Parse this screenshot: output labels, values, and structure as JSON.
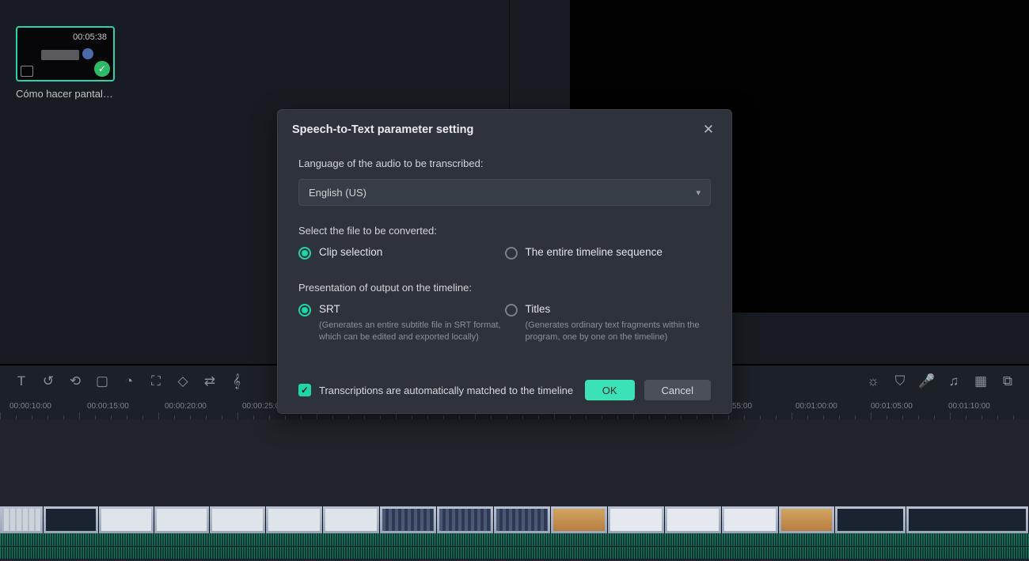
{
  "thumbnail": {
    "duration": "00:05:38",
    "caption": "Cómo hacer pantallas ..."
  },
  "dialog": {
    "title": "Speech-to-Text parameter setting",
    "language_label": "Language of the audio to be transcribed:",
    "language_value": "English (US)",
    "file_label": "Select the file to be converted:",
    "file_opt1": "Clip selection",
    "file_opt2": "The entire timeline sequence",
    "output_label": "Presentation of output on the timeline:",
    "out_opt1": "SRT",
    "out_opt1_desc": "(Generates an entire subtitle file in SRT format, which can be edited and exported locally)",
    "out_opt2": "Titles",
    "out_opt2_desc": "(Generates ordinary text fragments within the program, one by one on the timeline)",
    "auto_match": "Transcriptions are automatically matched to the timeline",
    "ok": "OK",
    "cancel": "Cancel"
  },
  "ruler": {
    "t0": "00:00:10:00",
    "t1": "00:00:15:00",
    "t2": "00:00:20:00",
    "t3": "00:00:25:0",
    "t4": "55:00",
    "t5": "00:01:00:00",
    "t6": "00:01:05:00",
    "t7": "00:01:10:00"
  }
}
